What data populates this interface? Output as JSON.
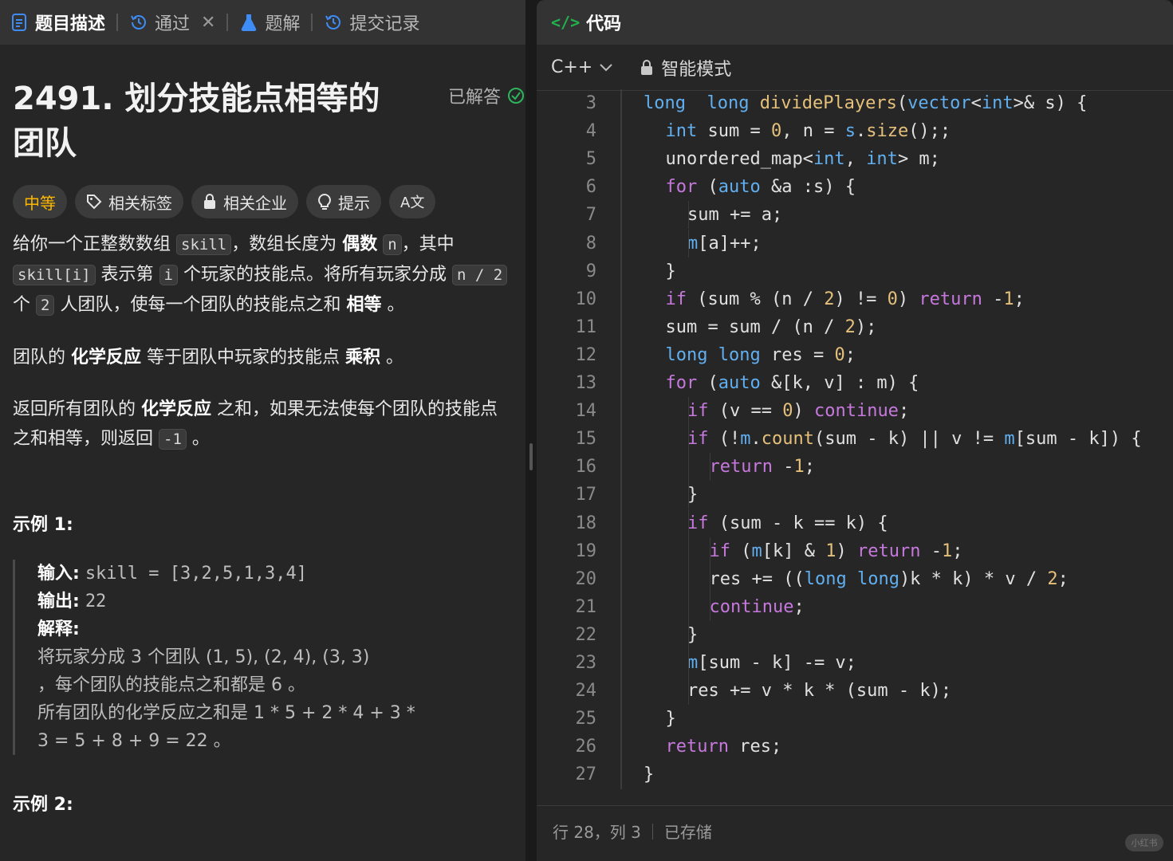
{
  "left": {
    "tabs": [
      {
        "label": "题目描述",
        "icon": "doc-icon"
      },
      {
        "label": "通过",
        "icon": "history-icon"
      },
      {
        "label": "题解",
        "icon": "flask-icon"
      },
      {
        "label": "提交记录",
        "icon": "history-icon"
      }
    ],
    "problem": {
      "title": "2491. 划分技能点相等的团队",
      "status": "已解答",
      "tags": [
        "中等",
        "相关标签",
        "相关企业",
        "提示"
      ],
      "translate_label": "A文"
    },
    "desc": {
      "p1_a": "给你一个正整数数组 ",
      "p1_code1": "skill",
      "p1_b": "，数组长度为 ",
      "p1_bold1": "偶数",
      "p1_code2": "n",
      "p1_c": "，其中 ",
      "p1_code3": "skill[i]",
      "p1_d": " 表示第 ",
      "p1_code4": "i",
      "p1_e": " 个玩家的技能点。将所有玩家分成 ",
      "p1_code5": "n / 2",
      "p1_f": " 个 ",
      "p1_code6": "2",
      "p1_g": " 人团队，使每一个团队的技能点之和 ",
      "p1_bold2": "相等",
      "p1_h": " 。",
      "p2_a": "团队的 ",
      "p2_bold1": "化学反应",
      "p2_b": " 等于团队中玩家的技能点 ",
      "p2_bold2": "乘积",
      "p2_c": " 。",
      "p3_a": "返回所有团队的 ",
      "p3_bold1": "化学反应",
      "p3_b": " 之和，如果无法使每个团队的技能点之和相等，则返回 ",
      "p3_code": "-1",
      "p3_c": " 。"
    },
    "example1": {
      "heading": "示例 1:",
      "input_label": "输入:",
      "input_value": "skill = [3,2,5,1,3,4]",
      "output_label": "输出:",
      "output_value": "22",
      "explain_label": "解释:",
      "explain_lines": [
        "将玩家分成 3 个团队 (1, 5), (2, 4), (3, 3)",
        "，每个团队的技能点之和都是 6 。",
        "所有团队的化学反应之和是 1 * 5 + 2 * 4 + 3 *",
        "3 = 5 + 8 + 9 = 22 。"
      ]
    },
    "example2_heading": "示例 2:"
  },
  "right": {
    "header_icon": "</>",
    "header_title": "代码",
    "language": "C++",
    "mode": "智能模式",
    "status_position": "行 28，列 3",
    "status_saved": "已存储",
    "watermark": "小红书"
  },
  "code_lines": [
    {
      "n": "3",
      "indent": 0,
      "tokens": [
        [
          "ty",
          "long"
        ],
        [
          "",
          "  "
        ],
        [
          "ty",
          "long"
        ],
        [
          "",
          " "
        ],
        [
          "fn",
          "dividePlayers"
        ],
        [
          "",
          "("
        ],
        [
          "ty",
          "vector"
        ],
        [
          "",
          "<"
        ],
        [
          "ty",
          "int"
        ],
        [
          "",
          ">& s) {"
        ]
      ]
    },
    {
      "n": "4",
      "indent": 1,
      "tokens": [
        [
          "ty",
          "int"
        ],
        [
          "",
          " sum = "
        ],
        [
          "num",
          "0"
        ],
        [
          "",
          ", n = "
        ],
        [
          "ty",
          "s"
        ],
        [
          "",
          "."
        ],
        [
          "fn",
          "size"
        ],
        [
          "",
          "();;"
        ]
      ]
    },
    {
      "n": "5",
      "indent": 1,
      "tokens": [
        [
          "",
          "unordered_map<"
        ],
        [
          "ty",
          "int"
        ],
        [
          "",
          ", "
        ],
        [
          "ty",
          "int"
        ],
        [
          "",
          "> m;"
        ]
      ]
    },
    {
      "n": "6",
      "indent": 1,
      "tokens": [
        [
          "kw",
          "for"
        ],
        [
          "",
          " ("
        ],
        [
          "ty",
          "auto"
        ],
        [
          "",
          " &a :s) {"
        ]
      ]
    },
    {
      "n": "7",
      "indent": 2,
      "tokens": [
        [
          "",
          "sum += a;"
        ]
      ]
    },
    {
      "n": "8",
      "indent": 2,
      "tokens": [
        [
          "ty",
          "m"
        ],
        [
          "",
          "[a]++;"
        ]
      ]
    },
    {
      "n": "9",
      "indent": 1,
      "tokens": [
        [
          "",
          "}"
        ]
      ]
    },
    {
      "n": "10",
      "indent": 1,
      "tokens": [
        [
          "kw",
          "if"
        ],
        [
          "",
          " (sum % (n / "
        ],
        [
          "num",
          "2"
        ],
        [
          "",
          ") != "
        ],
        [
          "num",
          "0"
        ],
        [
          "",
          ") "
        ],
        [
          "kw",
          "return"
        ],
        [
          "",
          " -"
        ],
        [
          "num",
          "1"
        ],
        [
          "",
          ";"
        ]
      ]
    },
    {
      "n": "11",
      "indent": 1,
      "tokens": [
        [
          "",
          "sum = sum / (n / "
        ],
        [
          "num",
          "2"
        ],
        [
          "",
          ");"
        ]
      ]
    },
    {
      "n": "12",
      "indent": 1,
      "tokens": [
        [
          "ty",
          "long"
        ],
        [
          "",
          " "
        ],
        [
          "ty",
          "long"
        ],
        [
          "",
          " res = "
        ],
        [
          "num",
          "0"
        ],
        [
          "",
          ";"
        ]
      ]
    },
    {
      "n": "13",
      "indent": 1,
      "tokens": [
        [
          "kw",
          "for"
        ],
        [
          "",
          " ("
        ],
        [
          "ty",
          "auto"
        ],
        [
          "",
          " &[k, v] : m) {"
        ]
      ]
    },
    {
      "n": "14",
      "indent": 2,
      "tokens": [
        [
          "kw",
          "if"
        ],
        [
          "",
          " (v == "
        ],
        [
          "num",
          "0"
        ],
        [
          "",
          ") "
        ],
        [
          "kw",
          "continue"
        ],
        [
          "",
          ";"
        ]
      ]
    },
    {
      "n": "15",
      "indent": 2,
      "tokens": [
        [
          "kw",
          "if"
        ],
        [
          "",
          " (!"
        ],
        [
          "ty",
          "m"
        ],
        [
          "",
          "."
        ],
        [
          "fn",
          "count"
        ],
        [
          "",
          "(sum - k) || v != "
        ],
        [
          "ty",
          "m"
        ],
        [
          "",
          "[sum - k]) {"
        ]
      ]
    },
    {
      "n": "16",
      "indent": 3,
      "tokens": [
        [
          "kw",
          "return"
        ],
        [
          "",
          " -"
        ],
        [
          "num",
          "1"
        ],
        [
          "",
          ";"
        ]
      ]
    },
    {
      "n": "17",
      "indent": 2,
      "tokens": [
        [
          "",
          "}"
        ]
      ]
    },
    {
      "n": "18",
      "indent": 2,
      "tokens": [
        [
          "kw",
          "if"
        ],
        [
          "",
          " (sum - k == k) {"
        ]
      ]
    },
    {
      "n": "19",
      "indent": 3,
      "tokens": [
        [
          "kw",
          "if"
        ],
        [
          "",
          " ("
        ],
        [
          "ty",
          "m"
        ],
        [
          "",
          "[k] & "
        ],
        [
          "num",
          "1"
        ],
        [
          "",
          ") "
        ],
        [
          "kw",
          "return"
        ],
        [
          "",
          " -"
        ],
        [
          "num",
          "1"
        ],
        [
          "",
          ";"
        ]
      ]
    },
    {
      "n": "20",
      "indent": 3,
      "tokens": [
        [
          "",
          "res += (("
        ],
        [
          "ty",
          "long"
        ],
        [
          "",
          " "
        ],
        [
          "ty",
          "long"
        ],
        [
          "",
          ")k * k) * v / "
        ],
        [
          "num",
          "2"
        ],
        [
          "",
          ";"
        ]
      ]
    },
    {
      "n": "21",
      "indent": 3,
      "tokens": [
        [
          "kw",
          "continue"
        ],
        [
          "",
          ";"
        ]
      ]
    },
    {
      "n": "22",
      "indent": 2,
      "tokens": [
        [
          "",
          "}"
        ]
      ]
    },
    {
      "n": "23",
      "indent": 2,
      "tokens": [
        [
          "ty",
          "m"
        ],
        [
          "",
          "[sum - k] -= v;"
        ]
      ]
    },
    {
      "n": "24",
      "indent": 2,
      "tokens": [
        [
          "",
          "res += v * k * (sum - k);"
        ]
      ]
    },
    {
      "n": "25",
      "indent": 1,
      "tokens": [
        [
          "",
          "}"
        ]
      ]
    },
    {
      "n": "26",
      "indent": 1,
      "tokens": [
        [
          "kw",
          "return"
        ],
        [
          "",
          " res;"
        ]
      ]
    },
    {
      "n": "27",
      "indent": 0,
      "tokens": [
        [
          "",
          "}"
        ]
      ]
    }
  ]
}
